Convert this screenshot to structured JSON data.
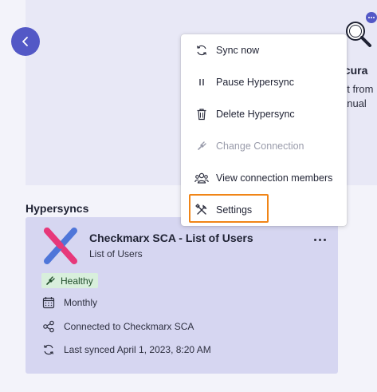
{
  "colors": {
    "accent": "#5358c6",
    "card_background": "#d6d6f1",
    "healthy_badge": "#d8efdc",
    "highlight": "#f08517"
  },
  "back_button": {
    "icon": "chevron-left-icon"
  },
  "background_panel": {
    "illustration": "magnifying-glass-icon",
    "heading_fragment": "ccura",
    "line_1_fragment": "nt from",
    "line_2_fragment": "anual"
  },
  "hypersyncs": {
    "section_title": "Hypersyncs",
    "card": {
      "logo": "checkmarx-logo",
      "title": "Checkmarx SCA - List of Users",
      "subtitle": "List of Users",
      "status": "Healthy",
      "frequency": "Monthly",
      "connection": "Connected to Checkmarx SCA",
      "last_synced": "Last synced April 1, 2023, 8:20 AM"
    }
  },
  "menu": {
    "items": [
      {
        "label": "Sync now",
        "icon": "sync-icon",
        "enabled": true
      },
      {
        "label": "Pause Hypersync",
        "icon": "pause-icon",
        "enabled": true
      },
      {
        "label": "Delete Hypersync",
        "icon": "trash-icon",
        "enabled": true
      },
      {
        "label": "Change Connection",
        "icon": "plug-icon",
        "enabled": false
      },
      {
        "label": "View connection members",
        "icon": "users-icon",
        "enabled": true
      },
      {
        "label": "Settings",
        "icon": "tools-icon",
        "enabled": true,
        "highlighted": true
      }
    ]
  }
}
